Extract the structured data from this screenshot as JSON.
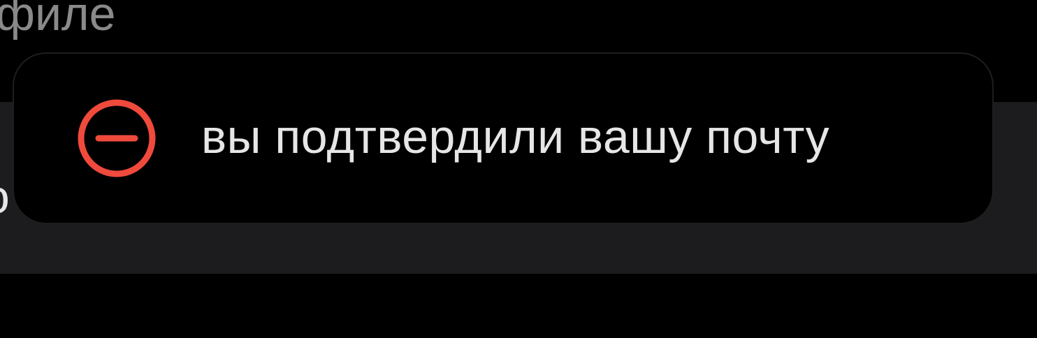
{
  "background": {
    "top_text": "филе",
    "panel_text": "о"
  },
  "toast": {
    "icon": "minus-circle-icon",
    "message": "вы подтвердили вашу почту",
    "accent_color": "#f04a3c",
    "text_color": "#e6e6e6"
  }
}
